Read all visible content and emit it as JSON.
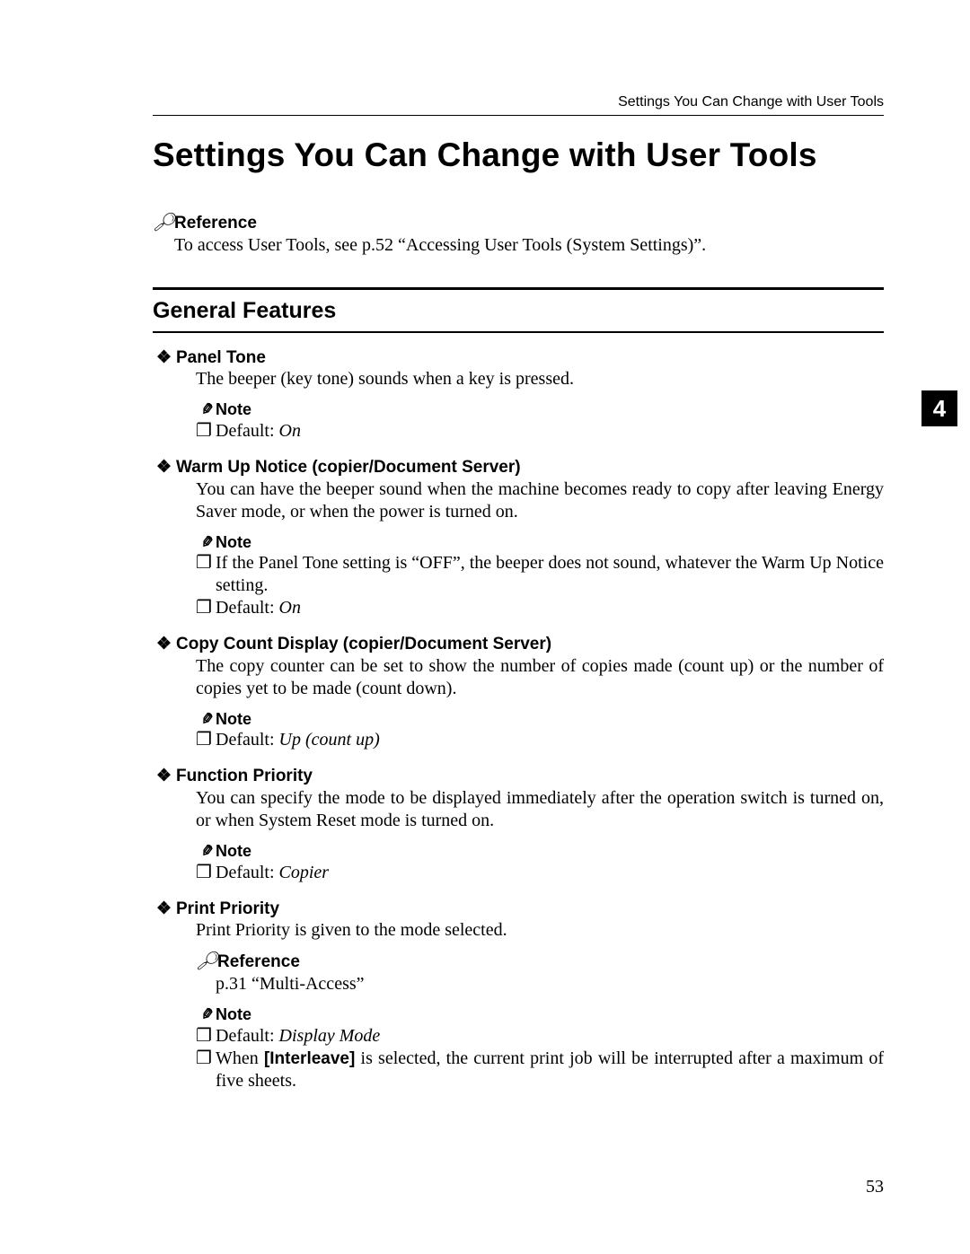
{
  "runningHeader": "Settings You Can Change with User Tools",
  "title": "Settings You Can Change with User Tools",
  "referenceLabel": "Reference",
  "referenceBody": "To access User Tools, see p.52 “Accessing User Tools (System Settings)”.",
  "sectionHeading": "General Features",
  "chapterTab": "4",
  "noteLabel": "Note",
  "defaultPrefix": "Default: ",
  "features": [
    {
      "title": "Panel Tone",
      "body": "The beeper (key tone) sounds when a key is pressed.",
      "notes": [
        {
          "text": "Default: ",
          "value": "On"
        }
      ]
    },
    {
      "title": "Warm Up Notice (copier/Document Server)",
      "body": "You can have the beeper sound when the machine becomes ready to copy after leaving Energy Saver mode, or when the power is turned on.",
      "notes": [
        {
          "text": "If the Panel Tone setting is “OFF”, the beeper does not sound, whatever the Warm Up Notice setting."
        },
        {
          "text": "Default: ",
          "value": "On"
        }
      ]
    },
    {
      "title": "Copy Count Display (copier/Document Server)",
      "body": "The copy counter can be set to show the number of copies made (count up) or the number of copies yet to be made (count down).",
      "notes": [
        {
          "text": "Default: ",
          "value": "Up (count up)"
        }
      ]
    },
    {
      "title": "Function Priority",
      "body": "You can specify the mode to be displayed immediately after the operation switch is turned on, or when System Reset mode is turned on.",
      "notes": [
        {
          "text": "Default: ",
          "value": "Copier"
        }
      ]
    },
    {
      "title": "Print Priority",
      "body": "Print Priority is given to the mode selected.",
      "reference": "p.31 “Multi-Access”",
      "notes": [
        {
          "text": "Default: ",
          "value": "Display Mode"
        },
        {
          "pre": "When ",
          "bracket": "[Interleave]",
          "post": " is selected, the current print job will be interrupted after a maximum of five sheets."
        }
      ]
    }
  ],
  "pageNumber": "53"
}
